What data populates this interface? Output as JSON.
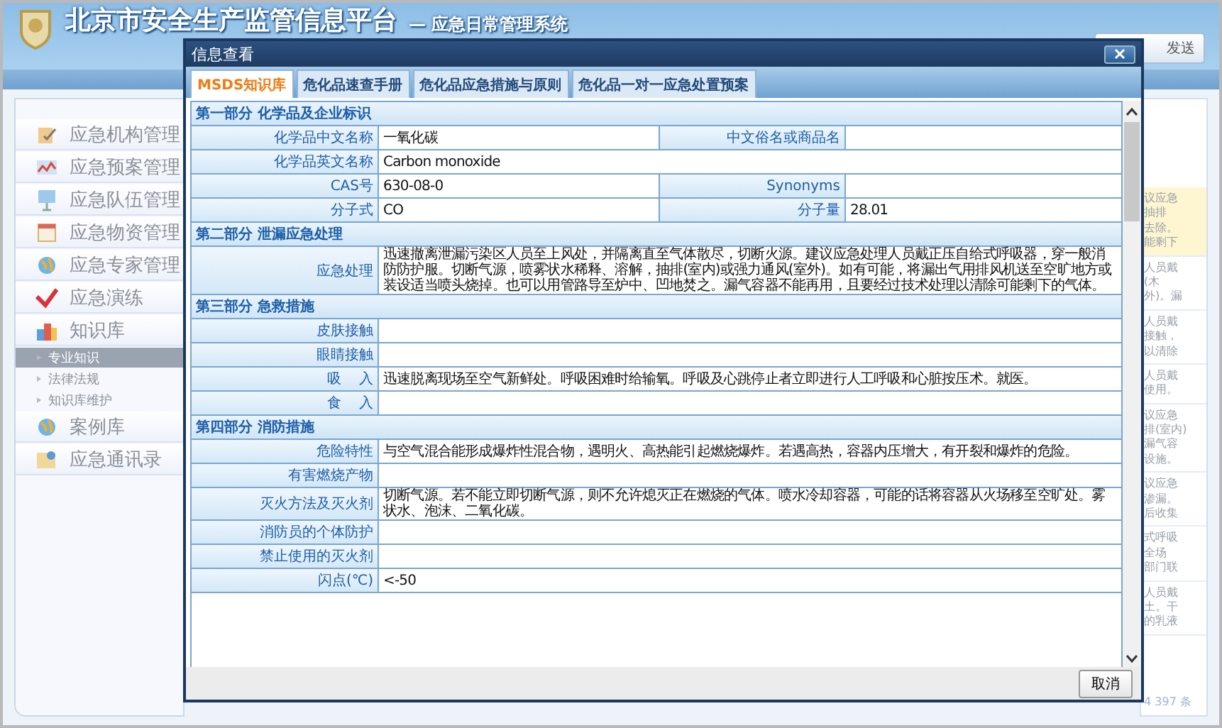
{
  "header": {
    "title": "北京市安全生产监管信息平台",
    "subtitle": "— 应急日常管理系统",
    "button": "发送"
  },
  "sidebar": {
    "items": [
      {
        "label": "应急机构管理"
      },
      {
        "label": "应急预案管理"
      },
      {
        "label": "应急队伍管理"
      },
      {
        "label": "应急物资管理"
      },
      {
        "label": "应急专家管理"
      },
      {
        "label": "应急演练"
      },
      {
        "label": "知识库",
        "children": [
          {
            "label": "专业知识",
            "selected": true
          },
          {
            "label": "法律法规",
            "selected": false
          },
          {
            "label": "知识库维护",
            "selected": false
          }
        ]
      },
      {
        "label": "案例库"
      },
      {
        "label": "应急通讯录"
      }
    ]
  },
  "background_panel": {
    "fragments": [
      {
        "lines": [
          "议应急",
          "抽排",
          "去除。",
          "能剩下"
        ],
        "highlighted": true
      },
      {
        "lines": [
          "人员戴",
          "(木",
          "外)。漏"
        ],
        "highlighted": false
      },
      {
        "lines": [
          "人员戴",
          "接触，",
          "以清除"
        ],
        "highlighted": false
      },
      {
        "lines": [
          "人员戴",
          "使用。"
        ],
        "highlighted": false
      },
      {
        "lines": [
          "议应急",
          "排(室内)",
          "漏气容",
          "设施。"
        ],
        "highlighted": false
      },
      {
        "lines": [
          "议应急",
          "渗漏。",
          "后收集"
        ],
        "highlighted": false
      },
      {
        "lines": [
          "式呼吸",
          "全场",
          "部门联"
        ],
        "highlighted": false
      },
      {
        "lines": [
          "人员戴",
          "土。干",
          "的乳液"
        ],
        "highlighted": false
      }
    ],
    "footer": "4 397 条"
  },
  "dialog": {
    "title": "信息查看",
    "tabs": [
      {
        "label": "MSDS知识库",
        "selected": true
      },
      {
        "label": "危化品速查手册",
        "selected": false
      },
      {
        "label": "危化品应急措施与原则",
        "selected": false
      },
      {
        "label": "危化品一对一应急处置预案",
        "selected": false
      }
    ],
    "sections": [
      {
        "title": "第一部分  化学品及企业标识",
        "rows": [
          {
            "kind": "pair",
            "cells": [
              {
                "label": "化学品中文名称",
                "value": "一氧化碳"
              },
              {
                "label": "中文俗名或商品名"
              }
            ]
          },
          {
            "kind": "full",
            "cells": [
              {
                "label": "化学品英文名称",
                "value": "Carbon monoxide"
              }
            ]
          },
          {
            "kind": "pair",
            "cells": [
              {
                "label": "CAS号",
                "value": "630-08-0"
              },
              {
                "label": "Synonyms"
              }
            ]
          },
          {
            "kind": "pair",
            "cells": [
              {
                "label": "分子式",
                "value": "CO"
              },
              {
                "label": "分子量",
                "value": "28.01"
              }
            ]
          }
        ]
      },
      {
        "title": "第二部分  泄漏应急处理",
        "rows": [
          {
            "kind": "full",
            "cells": [
              {
                "label": "应急处理",
                "value": "迅速撤离泄漏污染区人员至上风处，并隔离直至气体散尽，切断火源。建议应急处理人员戴正压自给式呼吸器，穿一般消防防护服。切断气源，喷雾状水稀释、溶解，抽排(室内)或强力通风(室外)。如有可能，将漏出气用排风机送至空旷地方或装设适当喷头烧掉。也可以用管路导至炉中、凹地焚之。漏气容器不能再用，且要经过技术处理以清除可能剩下的气体。"
              }
            ]
          }
        ]
      },
      {
        "title": "第三部分  急救措施",
        "rows": [
          {
            "kind": "full",
            "cells": [
              {
                "label": "皮肤接触"
              }
            ]
          },
          {
            "kind": "full",
            "cells": [
              {
                "label": "眼睛接触"
              }
            ]
          },
          {
            "kind": "full",
            "cells": [
              {
                "label": "吸    入",
                "value": "迅速脱离现场至空气新鲜处。呼吸困难时给输氧。呼吸及心跳停止者立即进行人工呼吸和心脏按压术。就医。"
              }
            ]
          },
          {
            "kind": "full",
            "cells": [
              {
                "label": "食    入"
              }
            ]
          }
        ]
      },
      {
        "title": "第四部分  消防措施",
        "rows": [
          {
            "kind": "full",
            "cells": [
              {
                "label": "危险特性",
                "value": "与空气混合能形成爆炸性混合物，遇明火、高热能引起燃烧爆炸。若遇高热，容器内压增大，有开裂和爆炸的危险。"
              }
            ]
          },
          {
            "kind": "full",
            "cells": [
              {
                "label": "有害燃烧产物"
              }
            ]
          },
          {
            "kind": "full",
            "cells": [
              {
                "label": "灭火方法及灭火剂",
                "value": "切断气源。若不能立即切断气源，则不允许熄灭正在燃烧的气体。喷水冷却容器，可能的话将容器从火场移至空旷处。雾状水、泡沫、二氧化碳。"
              }
            ]
          },
          {
            "kind": "full",
            "cells": [
              {
                "label": "消防员的个体防护"
              }
            ]
          },
          {
            "kind": "full",
            "cells": [
              {
                "label": "禁止使用的灭火剂"
              }
            ]
          },
          {
            "kind": "full",
            "cells": [
              {
                "label": "闪点(℃)",
                "value": "<-50"
              }
            ]
          }
        ]
      }
    ],
    "footer_button": "取消"
  }
}
